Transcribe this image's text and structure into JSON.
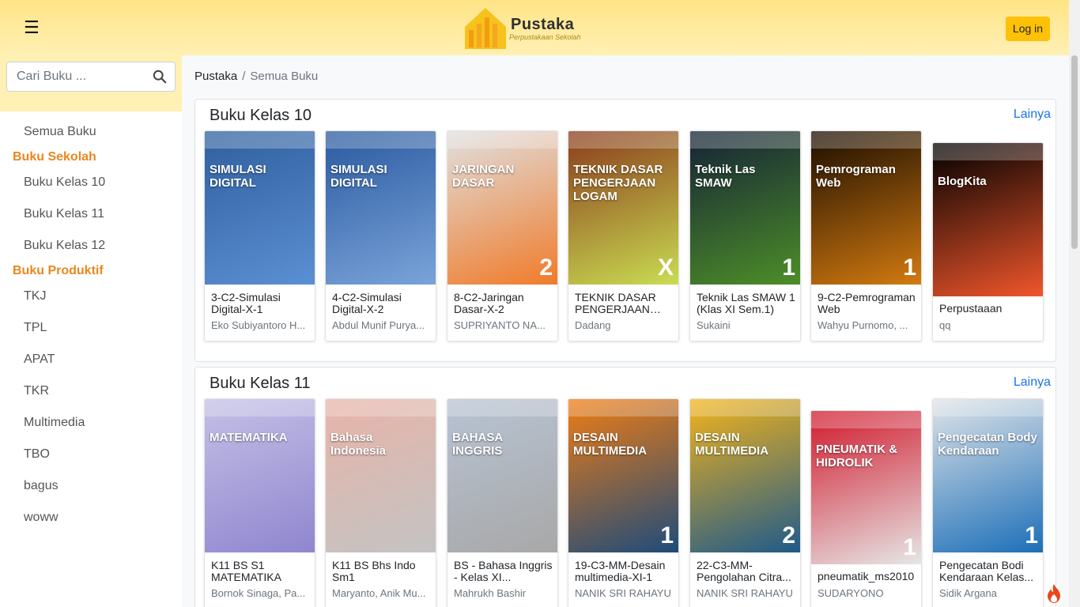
{
  "header": {
    "logo_text": "Pustaka",
    "logo_sub": "Perpustakaan Sekolah",
    "login_label": "Log in"
  },
  "sidebar": {
    "search_placeholder": "Cari Buku ...",
    "items": [
      {
        "label": "Semua Buku",
        "type": "item"
      },
      {
        "label": "Buku Sekolah",
        "type": "group"
      },
      {
        "label": "Buku Kelas 10",
        "type": "item"
      },
      {
        "label": "Buku Kelas 11",
        "type": "item"
      },
      {
        "label": "Buku Kelas 12",
        "type": "item"
      },
      {
        "label": "Buku Produktif",
        "type": "group"
      },
      {
        "label": "TKJ",
        "type": "item"
      },
      {
        "label": "TPL",
        "type": "item"
      },
      {
        "label": "APAT",
        "type": "item"
      },
      {
        "label": "TKR",
        "type": "item"
      },
      {
        "label": "Multimedia",
        "type": "item"
      },
      {
        "label": "TBO",
        "type": "item"
      },
      {
        "label": "bagus",
        "type": "item"
      },
      {
        "label": "woww",
        "type": "item"
      }
    ]
  },
  "breadcrumb": {
    "home": "Pustaka",
    "sep": "/",
    "current": "Semua Buku"
  },
  "sections": [
    {
      "title": "Buku Kelas 10",
      "more": "Lainya",
      "books": [
        {
          "title": "3-C2-Simulasi Digital-X-1",
          "author": "Eko Subiyantoro H...",
          "cover_text": "SIMULASI DIGITAL",
          "cover_num": "",
          "colors": [
            "#2f5f9e",
            "#5b8fd3"
          ]
        },
        {
          "title": "4-C2-Simulasi Digital-X-2",
          "author": "Abdul Munif Purya...",
          "cover_text": "SIMULASI DIGITAL",
          "cover_num": "",
          "colors": [
            "#2a5aa0",
            "#7aa3d9"
          ]
        },
        {
          "title": "8-C2-Jaringan Dasar-X-2",
          "author": "SUPRIYANTO NA...",
          "cover_text": "JARINGAN DASAR",
          "cover_num": "2",
          "colors": [
            "#e0e0e0",
            "#f07b2a"
          ]
        },
        {
          "title": "TEKNIK DASAR PENGERJAAN LOGAM",
          "author": "Dadang",
          "cover_text": "TEKNIK DASAR PENGERJAAN LOGAM",
          "cover_num": "X",
          "colors": [
            "#8a3b1c",
            "#c9dc52"
          ]
        },
        {
          "title": "Teknik Las SMAW 1 (Klas XI Sem.1)",
          "author": "Sukaini",
          "cover_text": "Teknik Las SMAW",
          "cover_num": "1",
          "colors": [
            "#152236",
            "#4c8e28"
          ]
        },
        {
          "title": "9-C2-Pemrograman Web",
          "author": "Wahyu Purnomo, ...",
          "cover_text": "Pemrograman Web",
          "cover_num": "1",
          "colors": [
            "#1a0d00",
            "#d37a10"
          ]
        },
        {
          "title": "Perpustaaan",
          "author": "qq",
          "cover_text": "BlogKita",
          "cover_num": "",
          "colors": [
            "#000000",
            "#f0562b"
          ]
        }
      ]
    },
    {
      "title": "Buku Kelas 11",
      "more": "Lainya",
      "books": [
        {
          "title": "K11 BS S1 MATEMATIKA",
          "author": "Bornok Sinaga, Pa...",
          "cover_text": "MATEMATIKA",
          "cover_num": "",
          "colors": [
            "#c4c0e6",
            "#8f86cf"
          ]
        },
        {
          "title": "K11 BS Bhs Indo Sm1",
          "author": "Maryanto, Anik Mu...",
          "cover_text": "Bahasa Indonesia",
          "cover_num": "",
          "colors": [
            "#e8b4a8",
            "#c3c3c3"
          ]
        },
        {
          "title": "BS - Bahasa Inggris - Kelas XI...",
          "author": "Mahrukh Bashir",
          "cover_text": "BAHASA INGGRIS",
          "cover_num": "",
          "colors": [
            "#b7c3d3",
            "#a8a8a8"
          ]
        },
        {
          "title": "19-C3-MM-Desain multimedia-XI-1",
          "author": "NANIK SRI RAHAYU",
          "cover_text": "DESAIN MULTIMEDIA",
          "cover_num": "1",
          "colors": [
            "#f07d14",
            "#1e4b7a"
          ]
        },
        {
          "title": "22-C3-MM-Pengolahan Citra...",
          "author": "NANIK SRI RAHAYU",
          "cover_text": "DESAIN MULTIMEDIA",
          "cover_num": "2",
          "colors": [
            "#f4b41a",
            "#1f5a8a"
          ]
        },
        {
          "title": "pneumatik_ms2010",
          "author": "SUDARYONO",
          "cover_text": "PNEUMATIK & HIDROLIK",
          "cover_num": "1",
          "colors": [
            "#d1192c",
            "#e6e6e6"
          ]
        },
        {
          "title": "Pengecatan Bodi Kendaraan Kelas...",
          "author": "Sidik Argana",
          "cover_text": "Pengecatan Body Kendaraan",
          "cover_num": "1",
          "colors": [
            "#e0e4e8",
            "#1c6fb8"
          ]
        }
      ]
    }
  ]
}
